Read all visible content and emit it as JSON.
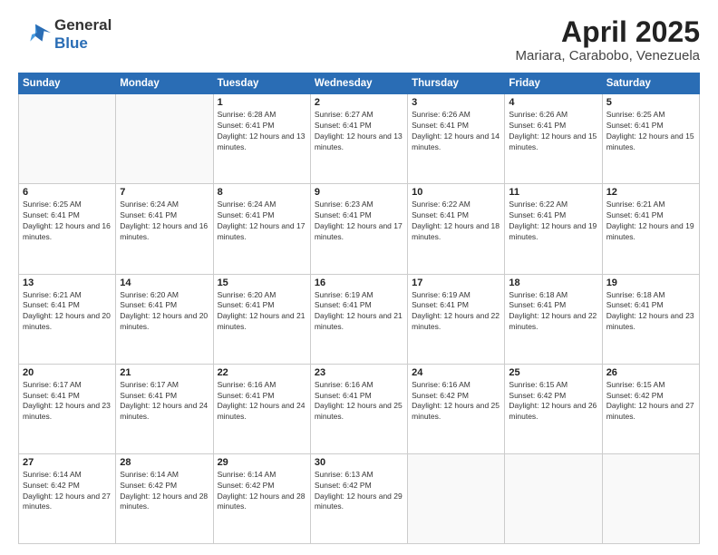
{
  "header": {
    "logo_general": "General",
    "logo_blue": "Blue",
    "month_title": "April 2025",
    "location": "Mariara, Carabobo, Venezuela"
  },
  "weekdays": [
    "Sunday",
    "Monday",
    "Tuesday",
    "Wednesday",
    "Thursday",
    "Friday",
    "Saturday"
  ],
  "weeks": [
    [
      {
        "day": "",
        "sunrise": "",
        "sunset": "",
        "daylight": ""
      },
      {
        "day": "",
        "sunrise": "",
        "sunset": "",
        "daylight": ""
      },
      {
        "day": "1",
        "sunrise": "Sunrise: 6:28 AM",
        "sunset": "Sunset: 6:41 PM",
        "daylight": "Daylight: 12 hours and 13 minutes."
      },
      {
        "day": "2",
        "sunrise": "Sunrise: 6:27 AM",
        "sunset": "Sunset: 6:41 PM",
        "daylight": "Daylight: 12 hours and 13 minutes."
      },
      {
        "day": "3",
        "sunrise": "Sunrise: 6:26 AM",
        "sunset": "Sunset: 6:41 PM",
        "daylight": "Daylight: 12 hours and 14 minutes."
      },
      {
        "day": "4",
        "sunrise": "Sunrise: 6:26 AM",
        "sunset": "Sunset: 6:41 PM",
        "daylight": "Daylight: 12 hours and 15 minutes."
      },
      {
        "day": "5",
        "sunrise": "Sunrise: 6:25 AM",
        "sunset": "Sunset: 6:41 PM",
        "daylight": "Daylight: 12 hours and 15 minutes."
      }
    ],
    [
      {
        "day": "6",
        "sunrise": "Sunrise: 6:25 AM",
        "sunset": "Sunset: 6:41 PM",
        "daylight": "Daylight: 12 hours and 16 minutes."
      },
      {
        "day": "7",
        "sunrise": "Sunrise: 6:24 AM",
        "sunset": "Sunset: 6:41 PM",
        "daylight": "Daylight: 12 hours and 16 minutes."
      },
      {
        "day": "8",
        "sunrise": "Sunrise: 6:24 AM",
        "sunset": "Sunset: 6:41 PM",
        "daylight": "Daylight: 12 hours and 17 minutes."
      },
      {
        "day": "9",
        "sunrise": "Sunrise: 6:23 AM",
        "sunset": "Sunset: 6:41 PM",
        "daylight": "Daylight: 12 hours and 17 minutes."
      },
      {
        "day": "10",
        "sunrise": "Sunrise: 6:22 AM",
        "sunset": "Sunset: 6:41 PM",
        "daylight": "Daylight: 12 hours and 18 minutes."
      },
      {
        "day": "11",
        "sunrise": "Sunrise: 6:22 AM",
        "sunset": "Sunset: 6:41 PM",
        "daylight": "Daylight: 12 hours and 19 minutes."
      },
      {
        "day": "12",
        "sunrise": "Sunrise: 6:21 AM",
        "sunset": "Sunset: 6:41 PM",
        "daylight": "Daylight: 12 hours and 19 minutes."
      }
    ],
    [
      {
        "day": "13",
        "sunrise": "Sunrise: 6:21 AM",
        "sunset": "Sunset: 6:41 PM",
        "daylight": "Daylight: 12 hours and 20 minutes."
      },
      {
        "day": "14",
        "sunrise": "Sunrise: 6:20 AM",
        "sunset": "Sunset: 6:41 PM",
        "daylight": "Daylight: 12 hours and 20 minutes."
      },
      {
        "day": "15",
        "sunrise": "Sunrise: 6:20 AM",
        "sunset": "Sunset: 6:41 PM",
        "daylight": "Daylight: 12 hours and 21 minutes."
      },
      {
        "day": "16",
        "sunrise": "Sunrise: 6:19 AM",
        "sunset": "Sunset: 6:41 PM",
        "daylight": "Daylight: 12 hours and 21 minutes."
      },
      {
        "day": "17",
        "sunrise": "Sunrise: 6:19 AM",
        "sunset": "Sunset: 6:41 PM",
        "daylight": "Daylight: 12 hours and 22 minutes."
      },
      {
        "day": "18",
        "sunrise": "Sunrise: 6:18 AM",
        "sunset": "Sunset: 6:41 PM",
        "daylight": "Daylight: 12 hours and 22 minutes."
      },
      {
        "day": "19",
        "sunrise": "Sunrise: 6:18 AM",
        "sunset": "Sunset: 6:41 PM",
        "daylight": "Daylight: 12 hours and 23 minutes."
      }
    ],
    [
      {
        "day": "20",
        "sunrise": "Sunrise: 6:17 AM",
        "sunset": "Sunset: 6:41 PM",
        "daylight": "Daylight: 12 hours and 23 minutes."
      },
      {
        "day": "21",
        "sunrise": "Sunrise: 6:17 AM",
        "sunset": "Sunset: 6:41 PM",
        "daylight": "Daylight: 12 hours and 24 minutes."
      },
      {
        "day": "22",
        "sunrise": "Sunrise: 6:16 AM",
        "sunset": "Sunset: 6:41 PM",
        "daylight": "Daylight: 12 hours and 24 minutes."
      },
      {
        "day": "23",
        "sunrise": "Sunrise: 6:16 AM",
        "sunset": "Sunset: 6:41 PM",
        "daylight": "Daylight: 12 hours and 25 minutes."
      },
      {
        "day": "24",
        "sunrise": "Sunrise: 6:16 AM",
        "sunset": "Sunset: 6:42 PM",
        "daylight": "Daylight: 12 hours and 25 minutes."
      },
      {
        "day": "25",
        "sunrise": "Sunrise: 6:15 AM",
        "sunset": "Sunset: 6:42 PM",
        "daylight": "Daylight: 12 hours and 26 minutes."
      },
      {
        "day": "26",
        "sunrise": "Sunrise: 6:15 AM",
        "sunset": "Sunset: 6:42 PM",
        "daylight": "Daylight: 12 hours and 27 minutes."
      }
    ],
    [
      {
        "day": "27",
        "sunrise": "Sunrise: 6:14 AM",
        "sunset": "Sunset: 6:42 PM",
        "daylight": "Daylight: 12 hours and 27 minutes."
      },
      {
        "day": "28",
        "sunrise": "Sunrise: 6:14 AM",
        "sunset": "Sunset: 6:42 PM",
        "daylight": "Daylight: 12 hours and 28 minutes."
      },
      {
        "day": "29",
        "sunrise": "Sunrise: 6:14 AM",
        "sunset": "Sunset: 6:42 PM",
        "daylight": "Daylight: 12 hours and 28 minutes."
      },
      {
        "day": "30",
        "sunrise": "Sunrise: 6:13 AM",
        "sunset": "Sunset: 6:42 PM",
        "daylight": "Daylight: 12 hours and 29 minutes."
      },
      {
        "day": "",
        "sunrise": "",
        "sunset": "",
        "daylight": ""
      },
      {
        "day": "",
        "sunrise": "",
        "sunset": "",
        "daylight": ""
      },
      {
        "day": "",
        "sunrise": "",
        "sunset": "",
        "daylight": ""
      }
    ]
  ]
}
